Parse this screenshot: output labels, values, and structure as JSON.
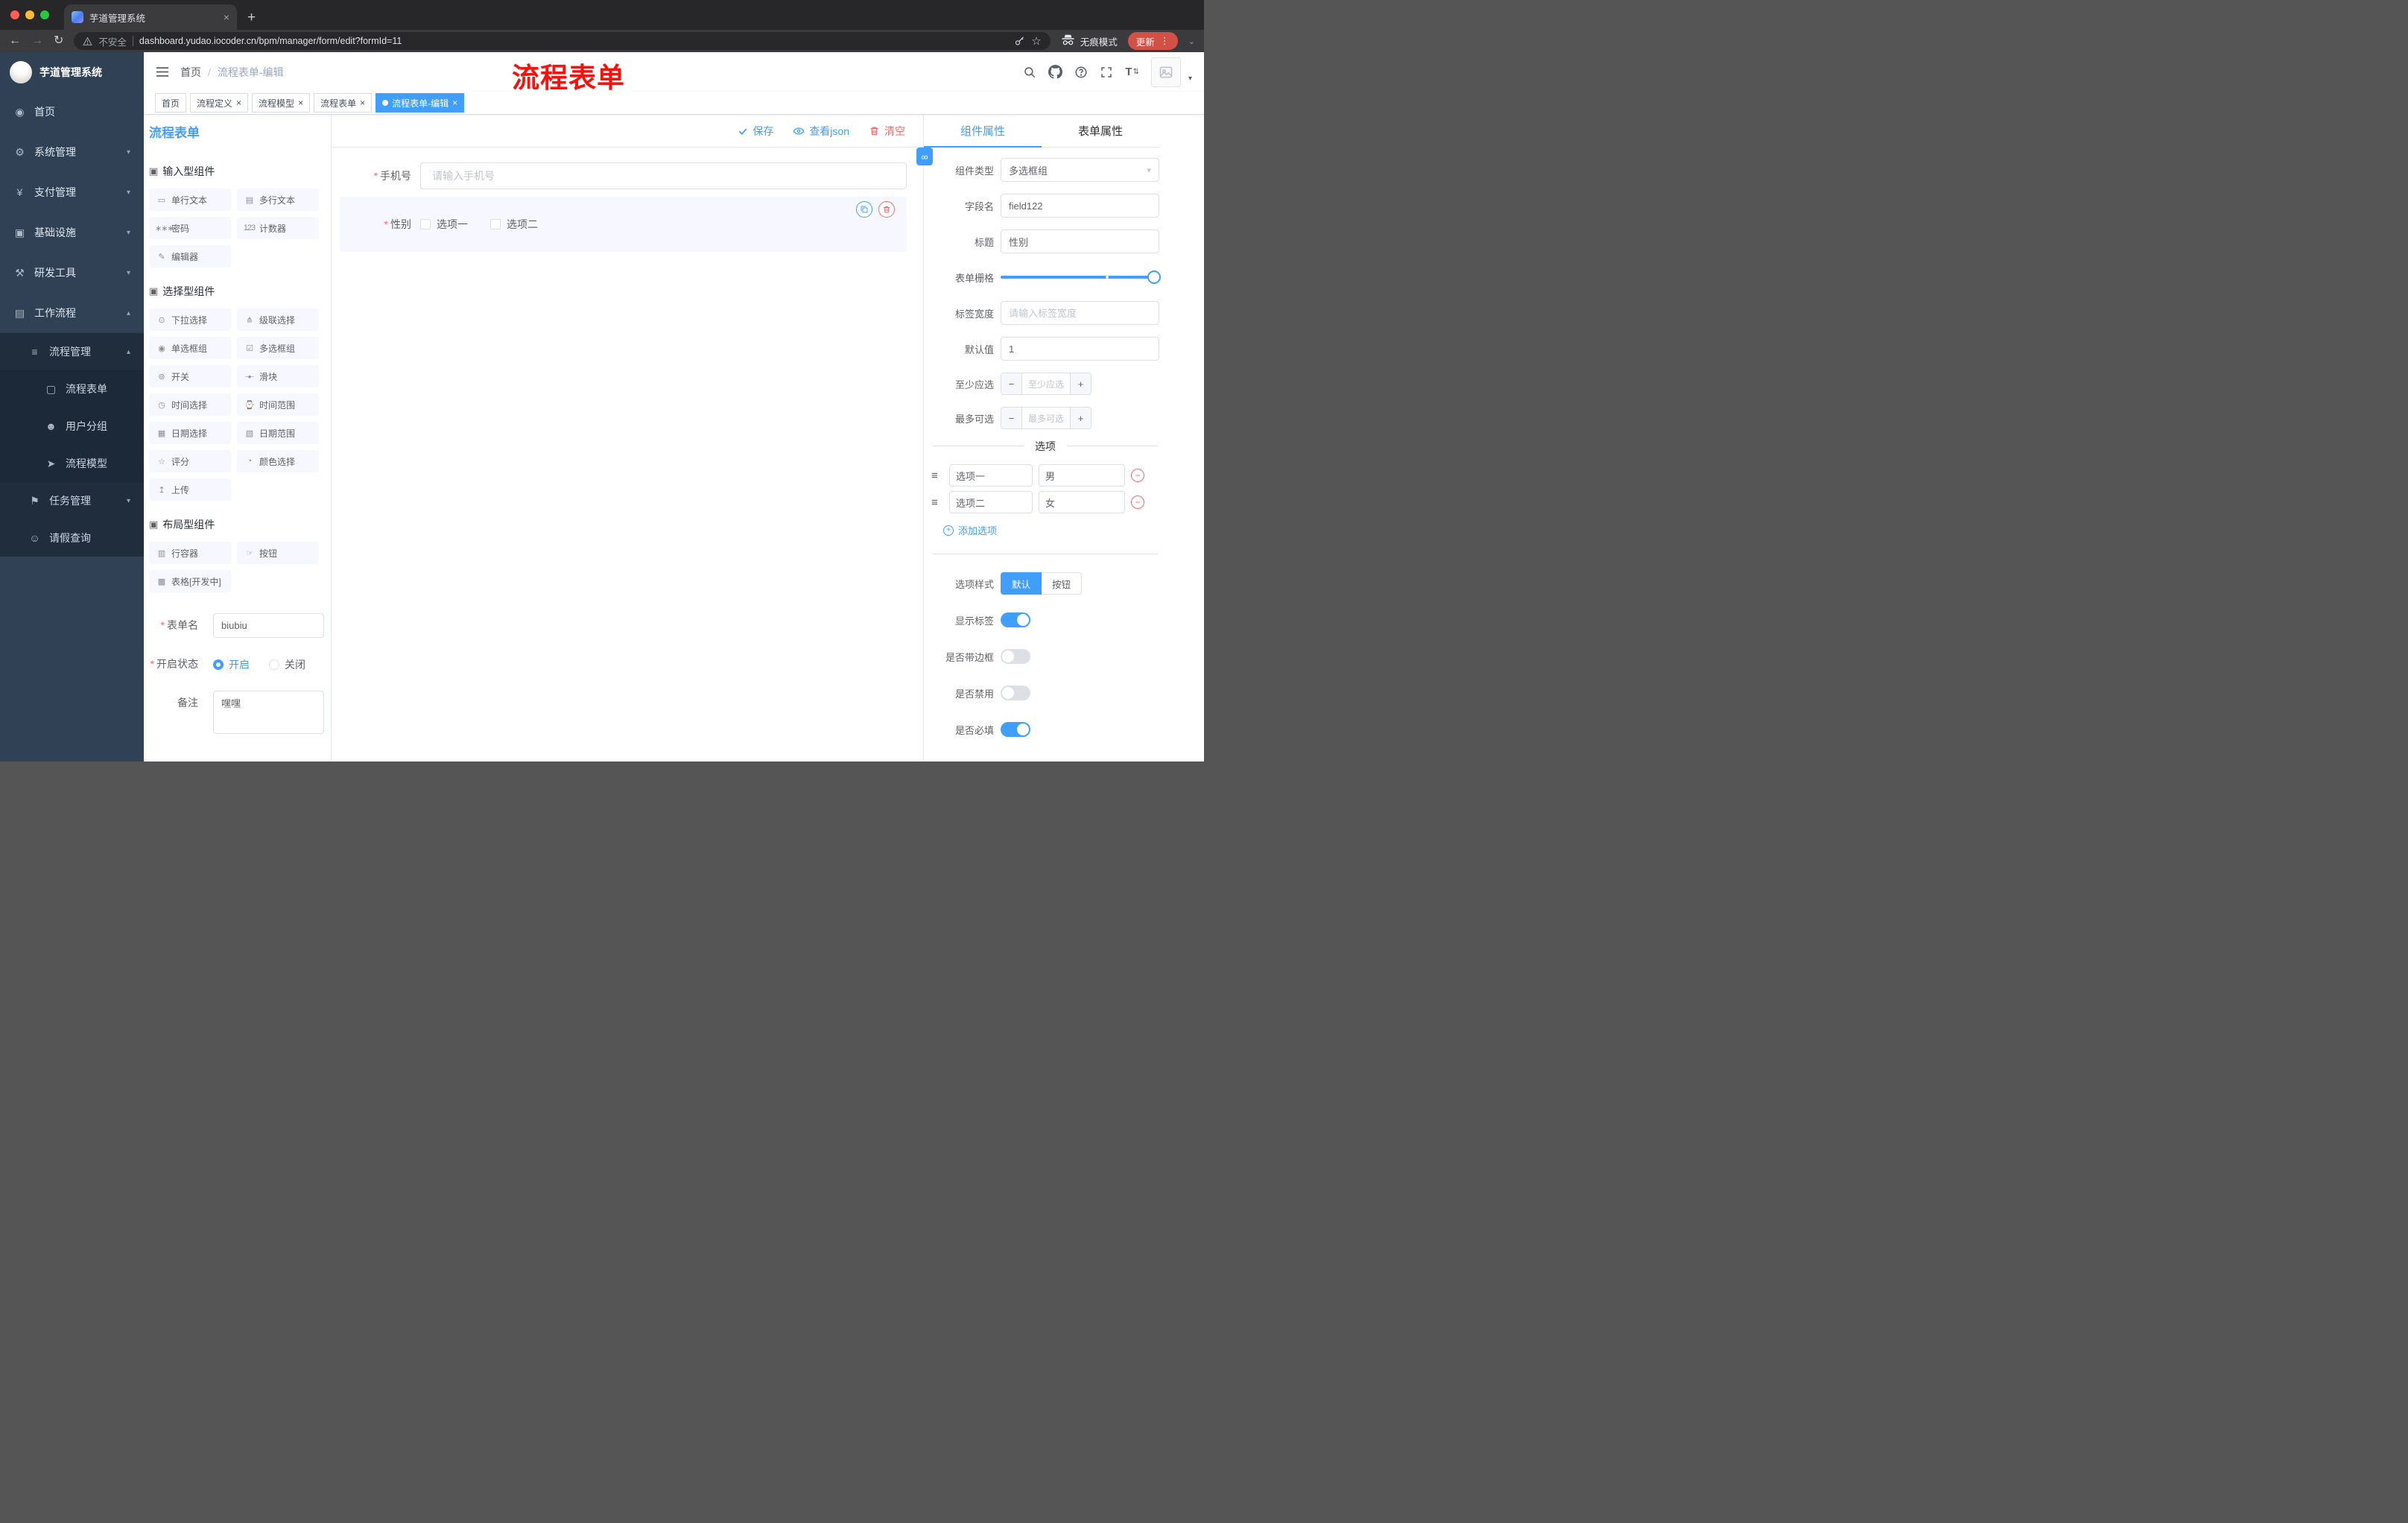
{
  "glyphs": {
    "required": "*",
    "close": "×",
    "plus": "+",
    "minus": "−",
    "kebab": "⋮",
    "chev_down": "▾",
    "chev_up": "▴",
    "chev_small_down": "⌄",
    "back": "←",
    "forward": "→",
    "reload": "↻",
    "star": "☆",
    "link": "∞",
    "drag": "≡",
    "dropdown": "▾",
    "font_main": "T",
    "font_arrows": "⇅"
  },
  "colors": {
    "accent": "#409eff",
    "danger": "#f56c6c",
    "sidebar": "#304156",
    "annotation": "#fb100c"
  },
  "browser": {
    "tab_title": "芋道管理系统",
    "security_label": "不安全",
    "url": "dashboard.yudao.iocoder.cn/bpm/manager/form/edit?formId=11",
    "incognito_label": "无痕模式",
    "update_label": "更新"
  },
  "sidebar": {
    "logo_title": "芋道管理系统",
    "items": [
      {
        "label": "首页",
        "glyph": "◉"
      },
      {
        "label": "系统管理",
        "glyph": "⚙"
      },
      {
        "label": "支付管理",
        "glyph": "¥"
      },
      {
        "label": "基础设施",
        "glyph": "▣"
      },
      {
        "label": "研发工具",
        "glyph": "⚒"
      },
      {
        "label": "工作流程",
        "glyph": "▤"
      },
      {
        "label": "流程管理",
        "glyph": "≡"
      },
      {
        "label": "流程表单",
        "glyph": "▢"
      },
      {
        "label": "用户分组",
        "glyph": "☻"
      },
      {
        "label": "流程模型",
        "glyph": "➤"
      },
      {
        "label": "任务管理",
        "glyph": "⚑"
      },
      {
        "label": "请假查询",
        "glyph": "☺"
      }
    ]
  },
  "navbar": {
    "breadcrumb_home": "首页",
    "breadcrumb_sep": "/",
    "breadcrumb_current": "流程表单-编辑"
  },
  "annotation": "流程表单",
  "tags": [
    {
      "label": "首页"
    },
    {
      "label": "流程定义"
    },
    {
      "label": "流程模型"
    },
    {
      "label": "流程表单"
    },
    {
      "label": "流程表单-编辑"
    }
  ],
  "designer": {
    "title": "流程表单",
    "save": "保存",
    "view_json": "查看json",
    "clear": "清空",
    "palette": {
      "sections": [
        {
          "title": "输入型组件",
          "icon": "▣",
          "items": [
            {
              "label": "单行文本",
              "glyph": "▭"
            },
            {
              "label": "多行文本",
              "glyph": "▤"
            },
            {
              "label": "密码",
              "glyph": "∗∗∗"
            },
            {
              "label": "计数器",
              "glyph": "123"
            },
            {
              "label": "编辑器",
              "glyph": "✎"
            }
          ]
        },
        {
          "title": "选择型组件",
          "icon": "▣",
          "items": [
            {
              "label": "下拉选择",
              "glyph": "⊙"
            },
            {
              "label": "级联选择",
              "glyph": "⋔"
            },
            {
              "label": "单选框组",
              "glyph": "◉"
            },
            {
              "label": "多选框组",
              "glyph": "☑"
            },
            {
              "label": "开关",
              "glyph": "⊚"
            },
            {
              "label": "滑块",
              "glyph": "−●−"
            },
            {
              "label": "时间选择",
              "glyph": "◷"
            },
            {
              "label": "时间范围",
              "glyph": "⌚"
            },
            {
              "label": "日期选择",
              "glyph": "▦"
            },
            {
              "label": "日期范围",
              "glyph": "▧"
            },
            {
              "label": "评分",
              "glyph": "☆"
            },
            {
              "label": "颜色选择",
              "glyph": "◔"
            },
            {
              "label": "上传",
              "glyph": "↥"
            }
          ]
        },
        {
          "title": "布局型组件",
          "icon": "▣",
          "items": [
            {
              "label": "行容器",
              "glyph": "▥"
            },
            {
              "label": "按钮",
              "glyph": "☞"
            },
            {
              "label": "表格[开发中]",
              "glyph": "▩"
            }
          ]
        }
      ]
    },
    "meta": {
      "name_label": "表单名",
      "name_value": "biubiu",
      "status_label": "开启状态",
      "status_on": "开启",
      "status_off": "关闭",
      "remark_label": "备注",
      "remark_value": "嘿嘿"
    },
    "canvas": {
      "phone_label": "手机号",
      "phone_placeholder": "请输入手机号",
      "gender_label": "性别",
      "gender_opt1": "选项一",
      "gender_opt2": "选项二"
    }
  },
  "inspector": {
    "tab_component": "组件属性",
    "tab_form": "表单属性",
    "type_label": "组件类型",
    "type_value": "多选框组",
    "field_label": "字段名",
    "field_value": "field122",
    "title_label": "标题",
    "title_value": "性别",
    "grid_label": "表单栅格",
    "width_label": "标签宽度",
    "width_placeholder": "请输入标签宽度",
    "default_label": "默认值",
    "default_value": "1",
    "min_label": "至少应选",
    "min_placeholder": "至少应选",
    "max_label": "最多可选",
    "max_placeholder": "最多可选",
    "options_divider": "选项",
    "option_rows": [
      {
        "label": "选项一",
        "value": "男"
      },
      {
        "label": "选项二",
        "value": "女"
      }
    ],
    "add_option": "添加选项",
    "option_style_label": "选项样式",
    "style_default": "默认",
    "style_button": "按钮",
    "show_label": "显示标签",
    "border_label": "是否带边框",
    "disabled_label": "是否禁用",
    "required_label": "是否必填"
  }
}
